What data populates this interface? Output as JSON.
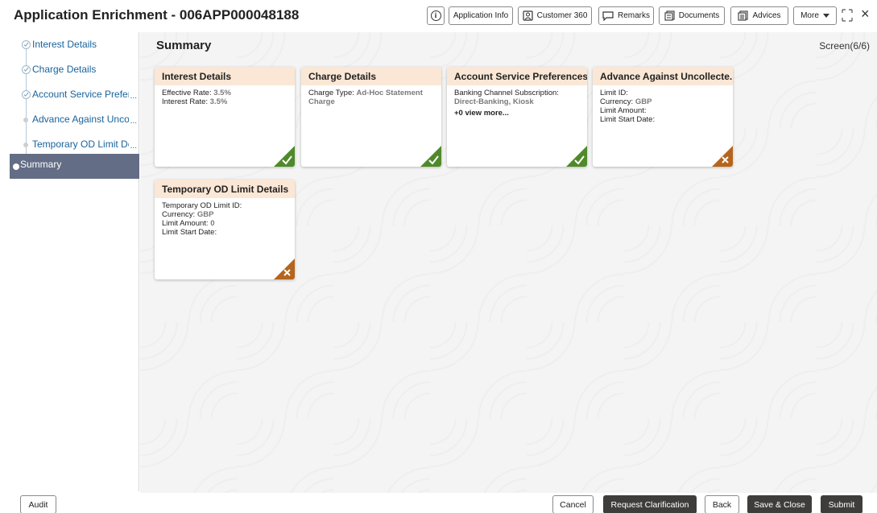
{
  "header": {
    "title": "Application Enrichment - 006APP000048188",
    "info_icon_glyph": "i",
    "buttons": {
      "application_info": "Application Info",
      "customer_360": "Customer 360",
      "remarks": "Remarks",
      "documents": "Documents",
      "advices": "Advices",
      "more": "More"
    },
    "close_glyph": "×"
  },
  "sidebar": {
    "items": [
      {
        "label": "Interest Details",
        "state": "complete"
      },
      {
        "label": "Charge Details",
        "state": "complete"
      },
      {
        "label": "Account Service Prefere",
        "state": "complete",
        "ellipsis": "..."
      },
      {
        "label": "Advance Against Uncoll",
        "state": "pending",
        "ellipsis": "..."
      },
      {
        "label": "Temporary OD Limit De",
        "state": "pending",
        "ellipsis": "..."
      },
      {
        "label": "Summary",
        "state": "active"
      }
    ]
  },
  "main": {
    "title": "Summary",
    "screen": "Screen(6/6)",
    "cards": [
      {
        "title": "Interest Details",
        "rows": [
          {
            "label": "Effective Rate:",
            "value": "3.5%"
          },
          {
            "label": "Interest Rate:",
            "value": "3.5%"
          }
        ],
        "status": "complete"
      },
      {
        "title": "Charge Details",
        "rows": [
          {
            "label": "Charge Type:",
            "value": "Ad-Hoc Statement Charge"
          }
        ],
        "status": "complete"
      },
      {
        "title": "Account Service Preferences",
        "rows": [
          {
            "label": "Banking Channel Subscription:",
            "value": "Direct-Banking, Kiosk"
          }
        ],
        "more": "+0 view more...",
        "status": "complete"
      },
      {
        "title": "Advance Against Uncollecte...",
        "rows": [
          {
            "label": "Limit ID:",
            "value": ""
          },
          {
            "label": "Currency:",
            "value": "GBP"
          },
          {
            "label": "Limit Amount:",
            "value": ""
          },
          {
            "label": "Limit Start Date:",
            "value": ""
          }
        ],
        "status": "incomplete"
      },
      {
        "title": "Temporary OD Limit Details",
        "rows": [
          {
            "label": "Temporary OD Limit ID:",
            "value": ""
          },
          {
            "label": "Currency:",
            "value": "GBP"
          },
          {
            "label": "Limit Amount:",
            "value": "0"
          },
          {
            "label": "Limit Start Date:",
            "value": ""
          }
        ],
        "status": "incomplete"
      }
    ]
  },
  "footer": {
    "audit": "Audit",
    "cancel": "Cancel",
    "request_clarification": "Request Clarification",
    "back": "Back",
    "save_close": "Save & Close",
    "submit": "Submit"
  },
  "colors": {
    "card_header": "#fbe7d5",
    "complete": "#4f8a2a",
    "incomplete": "#b5651d",
    "active_nav": "#636d85",
    "link": "#19639b",
    "dark_button": "#3f3d3b"
  }
}
